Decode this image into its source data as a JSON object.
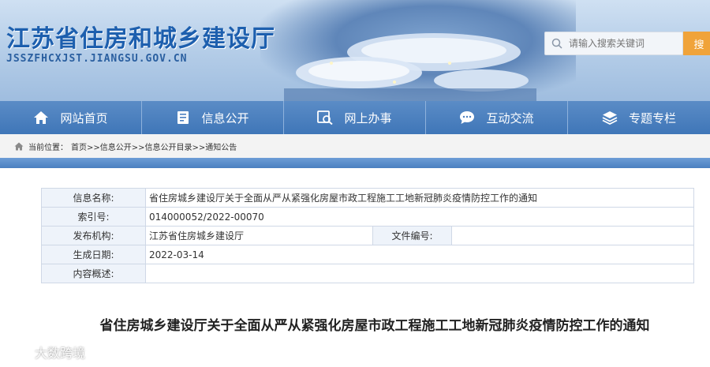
{
  "header": {
    "site_title": "江苏省住房和城乡建设厅",
    "site_domain": "JSSZFHCXJST.JIANGSU.GOV.CN",
    "search_placeholder": "请输入搜索关键词",
    "search_button": "搜"
  },
  "nav": {
    "items": [
      {
        "label": "网站首页",
        "icon": "home-icon"
      },
      {
        "label": "信息公开",
        "icon": "document-icon"
      },
      {
        "label": "网上办事",
        "icon": "service-icon"
      },
      {
        "label": "互动交流",
        "icon": "chat-icon"
      },
      {
        "label": "专题专栏",
        "icon": "layers-icon"
      }
    ]
  },
  "breadcrumb": {
    "prefix": "当前位置：",
    "path": "首页>>信息公开>>信息公开目录>>通知公告"
  },
  "info_table": {
    "name_label": "信息名称:",
    "name_value": "省住房城乡建设厅关于全面从严从紧强化房屋市政工程施工工地新冠肺炎疫情防控工作的通知",
    "index_label": "索引号:",
    "index_value": "014000052/2022-00070",
    "publisher_label": "发布机构:",
    "publisher_value": "江苏省住房城乡建设厅",
    "docno_label": "文件编号:",
    "docno_value": "",
    "date_label": "生成日期:",
    "date_value": "2022-03-14",
    "summary_label": "内容概述:",
    "summary_value": ""
  },
  "article": {
    "title": "省住房城乡建设厅关于全面从严从紧强化房屋市政工程施工工地新冠肺炎疫情防控工作的通知"
  },
  "watermark": {
    "text": "大数跨境"
  },
  "colors": {
    "brand_blue": "#1d5fae",
    "nav_blue": "#3f76b8",
    "search_orange": "#f0a33a"
  }
}
